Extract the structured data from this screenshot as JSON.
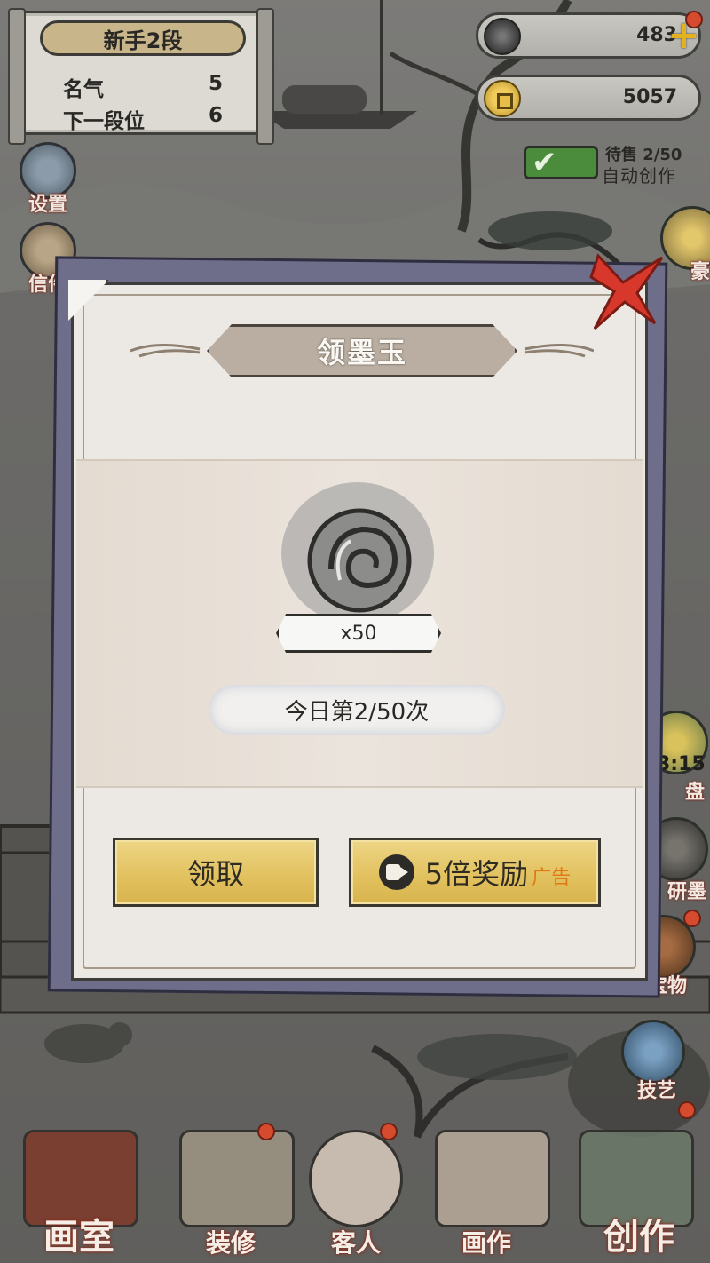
{
  "hud": {
    "rank_title": "新手2段",
    "fame_label": "名气",
    "fame_value": "5",
    "next_rank_label": "下一段位",
    "next_rank_value": "6",
    "ink_jade_amount": "483",
    "coins_amount": "5057",
    "auto_create_sale": "待售 2/50",
    "auto_create_label": "自动创作"
  },
  "left_buttons": [
    "设置",
    "信件"
  ],
  "right_buttons": [
    {
      "label": "豪"
    },
    {
      "label": "盘",
      "timer": "3:15"
    },
    {
      "label": "研墨"
    },
    {
      "label": "宝物"
    },
    {
      "label": "技艺"
    }
  ],
  "bottom_nav": [
    "画室",
    "装修",
    "客人",
    "画作",
    "创作"
  ],
  "modal": {
    "title": "领墨玉",
    "reward_amount": "x50",
    "daily_count": "今日第2/50次",
    "claim_label": "领取",
    "ad_claim_label": "5倍奖励",
    "ad_tag": "广告"
  },
  "colors": {
    "gold_button": "#e2c260",
    "modal_bg": "#ece8e3",
    "title_band": "#b9aea1",
    "ad_tag": "#e07a14",
    "close_x": "#d8382b",
    "label_outline": "#8a2a1a"
  }
}
